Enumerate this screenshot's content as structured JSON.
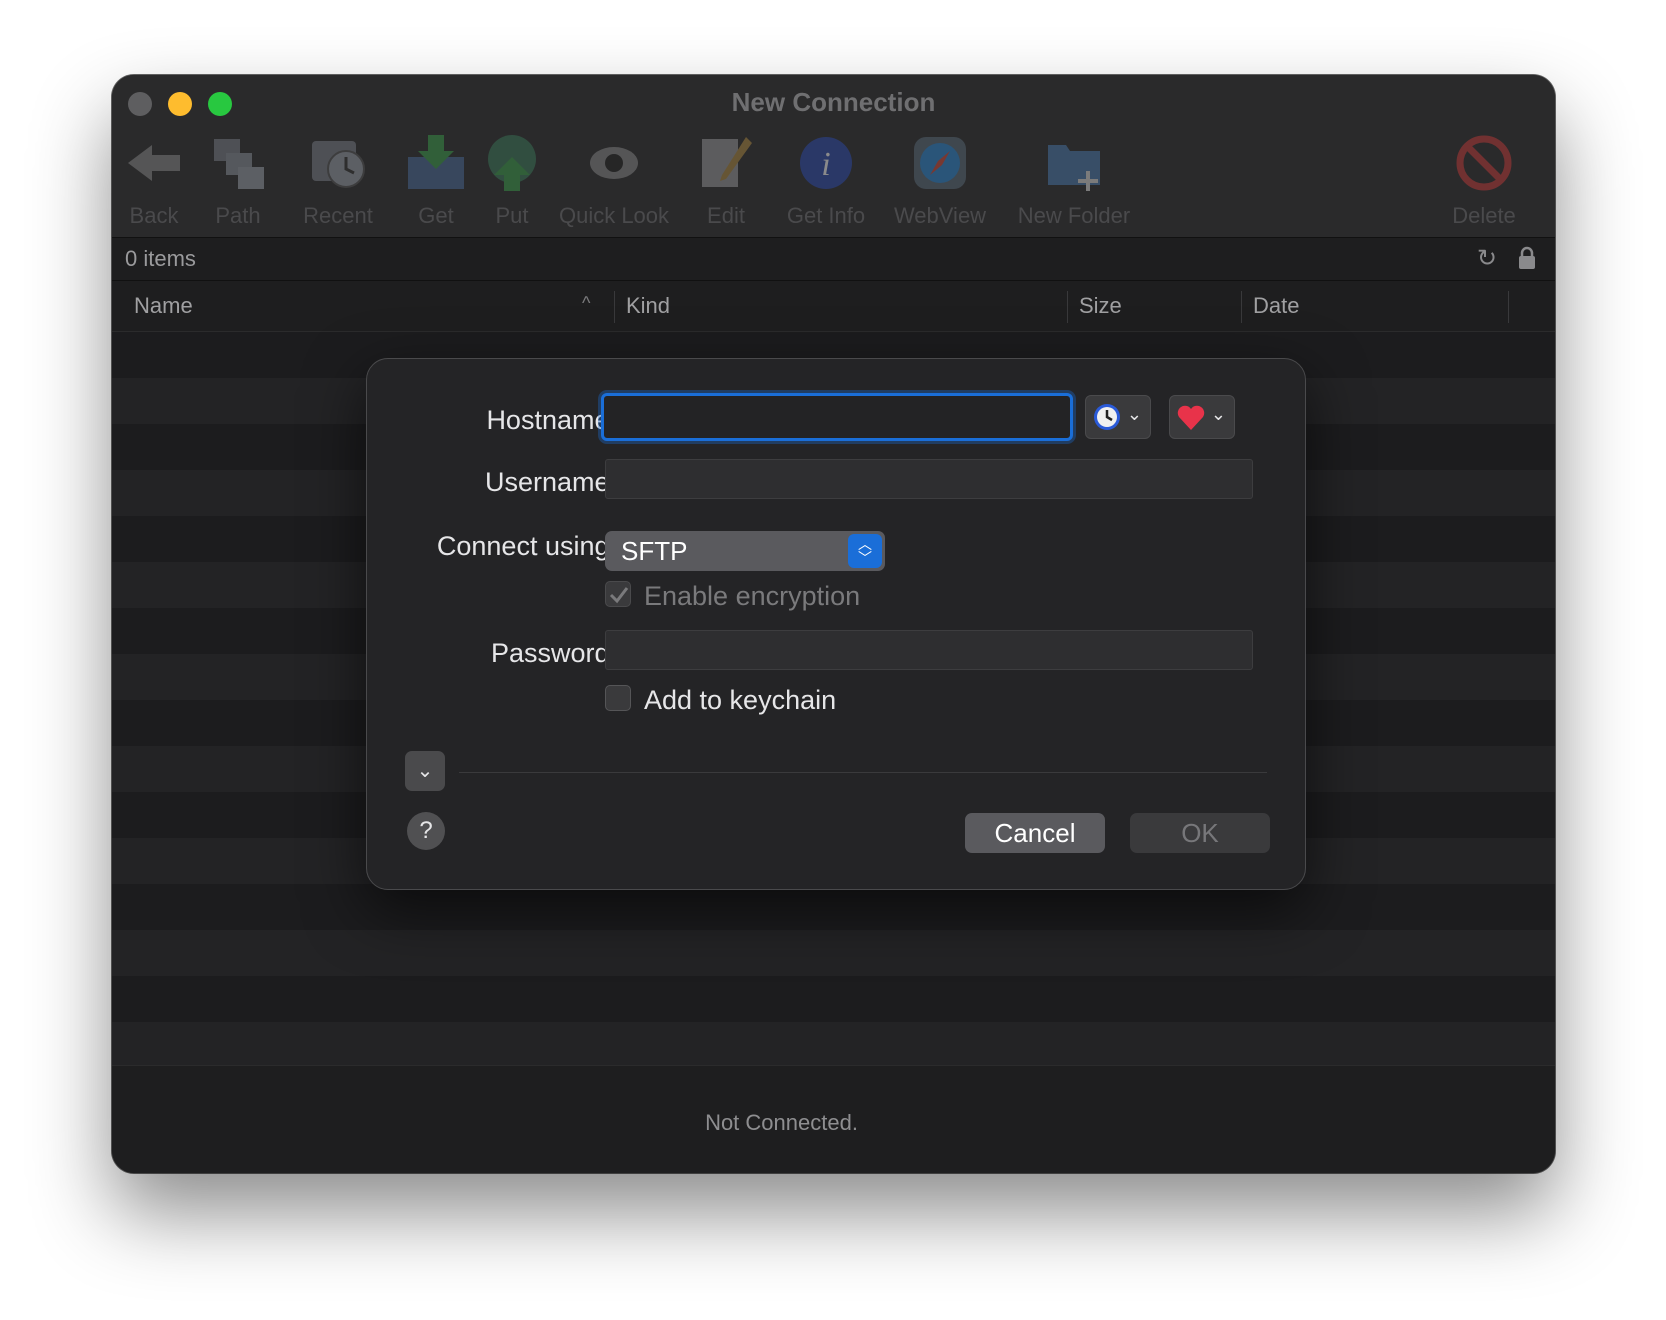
{
  "window": {
    "title": "New Connection"
  },
  "toolbar": {
    "items": [
      {
        "label": "Back",
        "icon": "back-arrow-icon"
      },
      {
        "label": "Path",
        "icon": "path-icon"
      },
      {
        "label": "Recent",
        "icon": "recent-clock-icon"
      },
      {
        "label": "Get",
        "icon": "download-icon"
      },
      {
        "label": "Put",
        "icon": "upload-icon"
      },
      {
        "label": "Quick Look",
        "icon": "eye-icon"
      },
      {
        "label": "Edit",
        "icon": "edit-pencil-icon"
      },
      {
        "label": "Get Info",
        "icon": "info-icon"
      },
      {
        "label": "WebView",
        "icon": "compass-icon"
      },
      {
        "label": "New Folder",
        "icon": "new-folder-icon"
      },
      {
        "label": "Delete",
        "icon": "delete-icon"
      }
    ]
  },
  "status": {
    "items_count": "0 items"
  },
  "table": {
    "columns": [
      "Name",
      "Kind",
      "Size",
      "Date"
    ]
  },
  "footer": {
    "connection_status": "Not Connected."
  },
  "dialog": {
    "hostname_label": "Hostname:",
    "hostname_value": "",
    "username_label": "Username:",
    "username_value": "",
    "connect_label": "Connect using:",
    "protocol": "SFTP",
    "encryption_label": "Enable encryption",
    "encryption_checked": true,
    "password_label": "Password:",
    "password_value": "",
    "keychain_label": "Add to keychain",
    "keychain_checked": false,
    "cancel_label": "Cancel",
    "ok_label": "OK",
    "help_label": "?"
  },
  "colors": {
    "accent": "#1a6ed8",
    "window_bg": "#1c1c1e",
    "dialog_bg": "#242426"
  }
}
